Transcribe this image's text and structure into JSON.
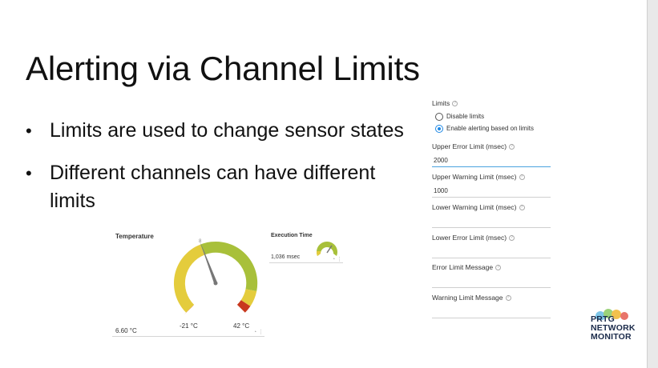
{
  "slide": {
    "title": "Alerting via Channel Limits",
    "bullets": [
      "Limits are used to change sensor states",
      "Different channels can have different limits"
    ]
  },
  "limits_panel": {
    "section_label": "Limits",
    "radio_options": [
      {
        "label": "Disable limits",
        "checked": false
      },
      {
        "label": "Enable alerting based on limits",
        "checked": true
      }
    ],
    "fields": [
      {
        "label": "Upper Error Limit (msec)",
        "value": "2000"
      },
      {
        "label": "Upper Warning Limit (msec)",
        "value": "1000"
      },
      {
        "label": "Lower Warning Limit (msec)",
        "value": ""
      },
      {
        "label": "Lower Error Limit (msec)",
        "value": ""
      },
      {
        "label": "Error Limit Message",
        "value": ""
      },
      {
        "label": "Warning Limit Message",
        "value": ""
      }
    ]
  },
  "temperature_gauge": {
    "title": "Temperature",
    "current_value": "6.60 °C",
    "min_label": "-21 °C",
    "max_label": "42 °C",
    "needle_mark": "8"
  },
  "execution_gauge": {
    "title": "Execution Time",
    "current_value": "1,036 msec"
  },
  "logo": {
    "lines": [
      "PRTG",
      "NETWORK",
      "MONITOR"
    ]
  },
  "colors": {
    "gauge_yellow": "#e4cc3c",
    "gauge_green": "#a8c03a",
    "gauge_red": "#c8381e",
    "needle": "#777777",
    "focus_blue": "#4aa3df",
    "radio_blue": "#1e88e5"
  }
}
